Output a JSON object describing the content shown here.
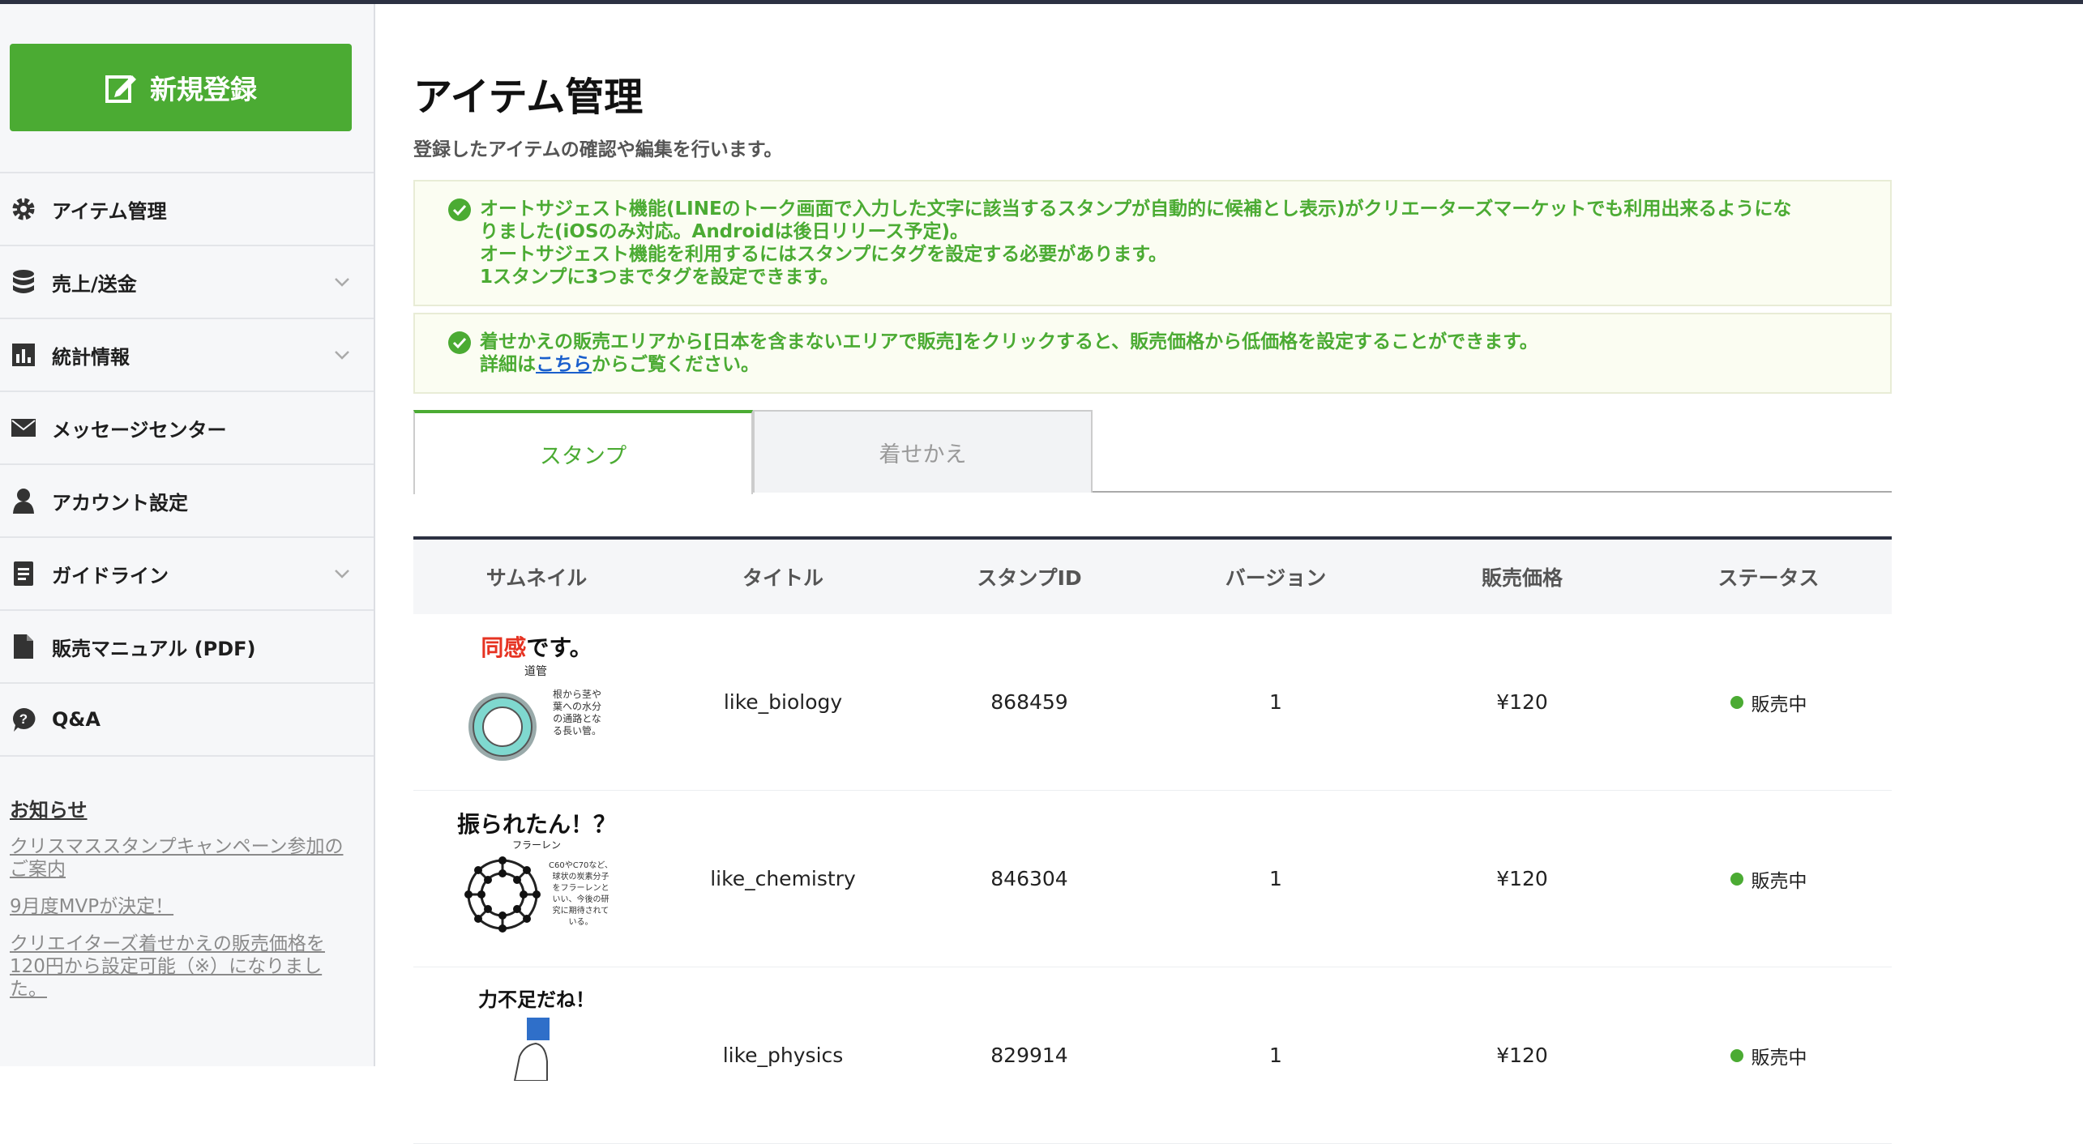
{
  "sidebar": {
    "new_button_label": "新規登録",
    "menu": [
      {
        "label": "アイテム管理",
        "icon": "gear-icon",
        "has_chevron": false
      },
      {
        "label": "売上/送金",
        "icon": "database-icon",
        "has_chevron": true
      },
      {
        "label": "統計情報",
        "icon": "bar-chart-icon",
        "has_chevron": true
      },
      {
        "label": "メッセージセンター",
        "icon": "envelope-icon",
        "has_chevron": false
      },
      {
        "label": "アカウント設定",
        "icon": "user-icon",
        "has_chevron": false
      },
      {
        "label": "ガイドライン",
        "icon": "document-icon",
        "has_chevron": true
      },
      {
        "label": "販売マニュアル (PDF)",
        "icon": "file-icon",
        "has_chevron": false
      },
      {
        "label": "Q&A",
        "icon": "question-bubble-icon",
        "has_chevron": false
      }
    ],
    "news": {
      "title": "お知らせ",
      "links": [
        "クリスマススタンプキャンペーン参加のご案内",
        "9月度MVPが決定！",
        "クリエイターズ着せかえの販売価格を120円から設定可能（※）になりました。"
      ]
    }
  },
  "main": {
    "title": "アイテム管理",
    "description": "登録したアイテムの確認や編集を行います。",
    "notice1": {
      "line1": "オートサジェスト機能(LINEのトーク画面で入力した文字に該当するスタンプが自動的に候補とし表示)がクリエーターズマーケットでも利用出来るようにな",
      "line2": "りました(iOSのみ対応。Androidは後日リリース予定)。",
      "line3": "オートサジェスト機能を利用するにはスタンプにタグを設定する必要があります。",
      "line4": "1スタンプに3つまでタグを設定できます。"
    },
    "notice2": {
      "line1": "着せかえの販売エリアから[日本を含まないエリアで販売]をクリックすると、販売価格から低価格を設定することができます。",
      "line2_prefix": "詳細は",
      "line2_link": "こちら",
      "line2_suffix": "からご覧ください。"
    },
    "tabs": [
      {
        "label": "スタンプ",
        "active": true
      },
      {
        "label": "着せかえ",
        "active": false
      }
    ],
    "table": {
      "headers": [
        "サムネイル",
        "タイトル",
        "スタンプID",
        "バージョン",
        "販売価格",
        "ステータス"
      ],
      "rows": [
        {
          "thumb": {
            "caption_red": "同感",
            "caption": "です。",
            "sub": "道管",
            "note": [
              "根から茎や",
              "葉への水分",
              "の通路とな",
              "る長い管。"
            ]
          },
          "title": "like_biology",
          "id": "868459",
          "version": "1",
          "price": "¥120",
          "status": "販売中"
        },
        {
          "thumb": {
            "caption_red": "",
            "caption": "振られたん！？",
            "sub": "フラーレン",
            "note": [
              "C60やC70など、",
              "球状の炭素分子",
              "をフラーレンと",
              "いい、今後の研",
              "究に期待されて",
              "いる。"
            ]
          },
          "title": "like_chemistry",
          "id": "846304",
          "version": "1",
          "price": "¥120",
          "status": "販売中"
        },
        {
          "thumb": {
            "caption_red": "",
            "caption": "力不足だね！",
            "sub": "",
            "note": []
          },
          "title": "like_physics",
          "id": "829914",
          "version": "1",
          "price": "¥120",
          "status": "販売中"
        }
      ]
    }
  },
  "colors": {
    "accent": "#4bab33",
    "link": "#1a5fcc",
    "header_bar": "#2c3142"
  }
}
